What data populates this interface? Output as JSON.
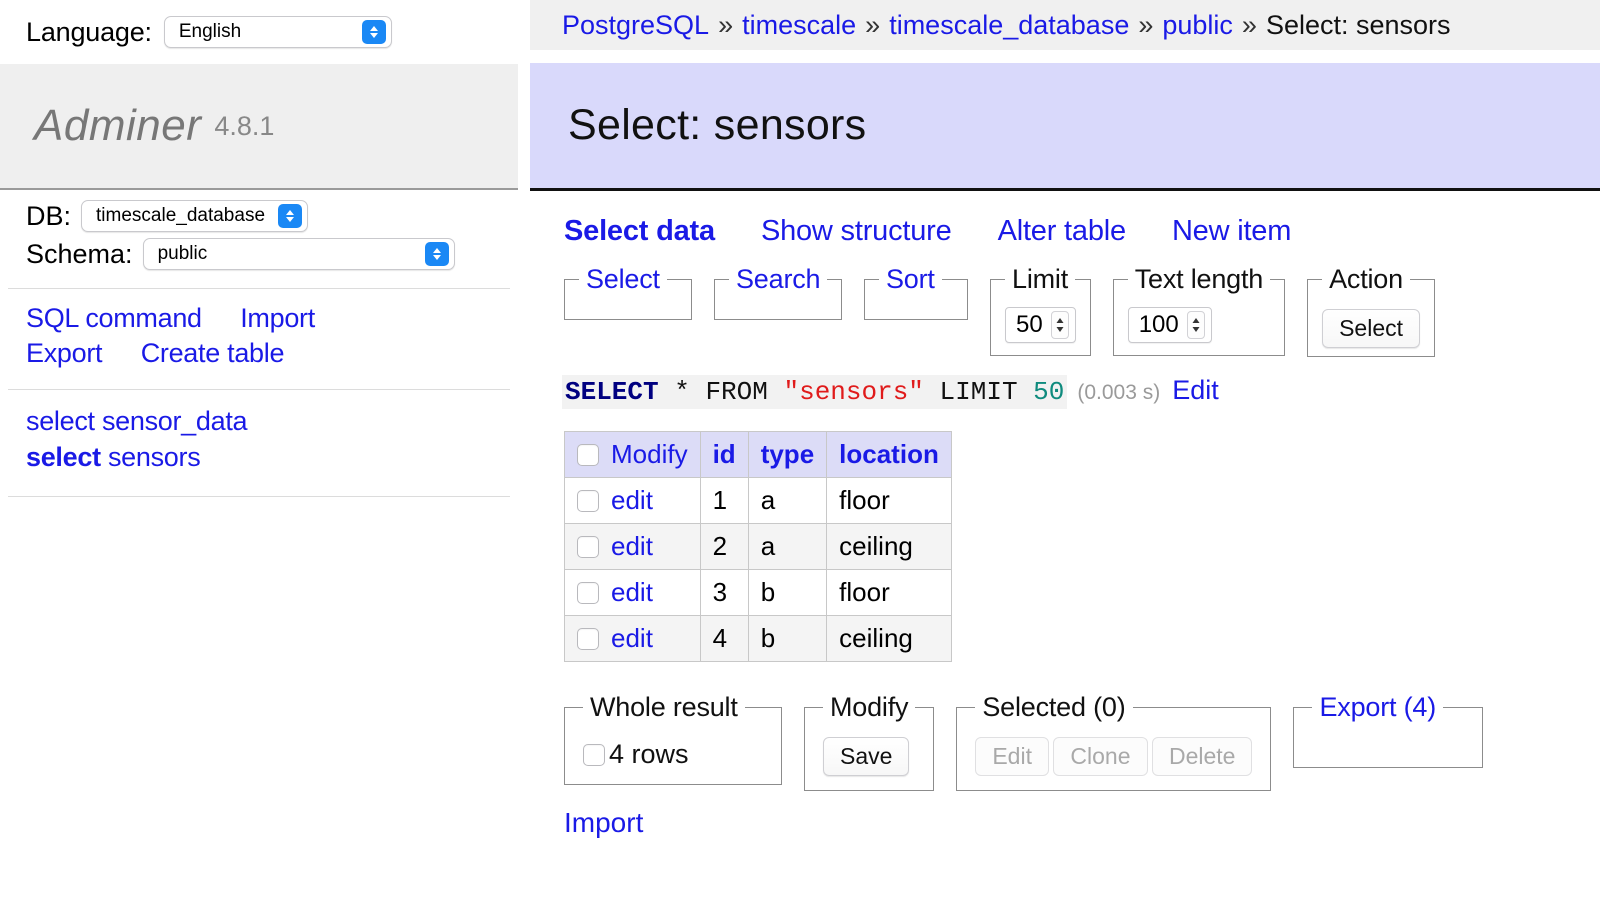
{
  "sidebar": {
    "language_label": "Language:",
    "language_value": "English",
    "logo_name": "Adminer",
    "logo_version": "4.8.1",
    "db_label": "DB:",
    "db_value": "timescale_database",
    "schema_label": "Schema:",
    "schema_value": "public",
    "actions": [
      {
        "label": "SQL command"
      },
      {
        "label": "Import"
      },
      {
        "label": "Export"
      },
      {
        "label": "Create table"
      }
    ],
    "tables": [
      {
        "prefix": "select",
        "name": "sensor_data",
        "active": false
      },
      {
        "prefix": "select",
        "name": "sensors",
        "active": true
      }
    ]
  },
  "breadcrumb": {
    "items": [
      {
        "label": "PostgreSQL",
        "link": true
      },
      {
        "label": "timescale",
        "link": true
      },
      {
        "label": "timescale_database",
        "link": true
      },
      {
        "label": "public",
        "link": true
      },
      {
        "label": "Select: sensors",
        "link": false
      }
    ],
    "separator": "»"
  },
  "page": {
    "title": "Select: sensors"
  },
  "tabs": [
    {
      "label": "Select data",
      "active": true
    },
    {
      "label": "Show structure",
      "active": false
    },
    {
      "label": "Alter table",
      "active": false
    },
    {
      "label": "New item",
      "active": false
    }
  ],
  "toolbar": {
    "select_legend": "Select",
    "search_legend": "Search",
    "sort_legend": "Sort",
    "limit_legend": "Limit",
    "limit_value": "50",
    "textlength_legend": "Text length",
    "textlength_value": "100",
    "action_legend": "Action",
    "action_button": "Select"
  },
  "query": {
    "keyword1": "SELECT",
    "star": "*",
    "keyword2": "FROM",
    "table": "\"sensors\"",
    "keyword3": "LIMIT",
    "limit": "50",
    "duration": "(0.003 s)",
    "edit_link": "Edit"
  },
  "table": {
    "columns": [
      "Modify",
      "id",
      "type",
      "location"
    ],
    "rows": [
      {
        "edit": "edit",
        "id": "1",
        "type": "a",
        "location": "floor"
      },
      {
        "edit": "edit",
        "id": "2",
        "type": "a",
        "location": "ceiling"
      },
      {
        "edit": "edit",
        "id": "3",
        "type": "b",
        "location": "floor"
      },
      {
        "edit": "edit",
        "id": "4",
        "type": "b",
        "location": "ceiling"
      }
    ]
  },
  "footer": {
    "whole_result_legend": "Whole result",
    "row_count": "4 rows",
    "modify_legend": "Modify",
    "save_button": "Save",
    "selected_legend": "Selected (0)",
    "edit_button": "Edit",
    "clone_button": "Clone",
    "delete_button": "Delete",
    "export_legend": "Export (4)",
    "import_link": "Import"
  },
  "colors": {
    "link": "#1a1ae6",
    "title_bg": "#d9d9fb",
    "header_bg": "#dcdcf7",
    "breadcrumb_bg": "#f0f0f0",
    "sql_keyword": "#000080",
    "sql_string": "#e01b1b",
    "sql_number": "#0f8b7e"
  }
}
